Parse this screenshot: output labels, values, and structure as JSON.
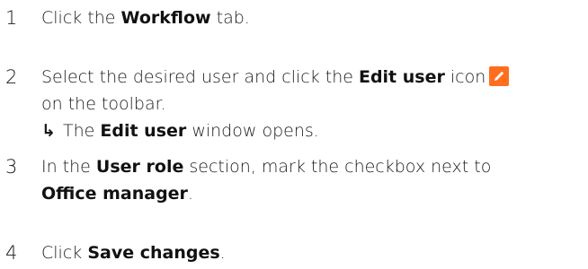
{
  "colors": {
    "text": "#1a1a1a",
    "edit_icon_bg": "#ff6e1e",
    "edit_icon_fg": "#ffffff"
  },
  "icons": {
    "edit_user": "pencil-icon",
    "result_arrow": "return-arrow-icon"
  },
  "steps": [
    {
      "number": "1",
      "t1": "Click the ",
      "b1": "Workflow",
      "t2": " tab."
    },
    {
      "number": "2",
      "t1": "Select the desired user and click the ",
      "b1": "Edit user",
      "t2": " icon",
      "t3": "on the toolbar.",
      "result_arrow": "↳",
      "result_t1": "The ",
      "result_b1": "Edit user",
      "result_t2": " window opens."
    },
    {
      "number": "3",
      "t1": "In the ",
      "b1": "User role",
      "t2": " section, mark the checkbox next to",
      "b2": "Office manager",
      "t3": "."
    },
    {
      "number": "4",
      "t1": "Click ",
      "b1": "Save changes",
      "t2": "."
    }
  ]
}
